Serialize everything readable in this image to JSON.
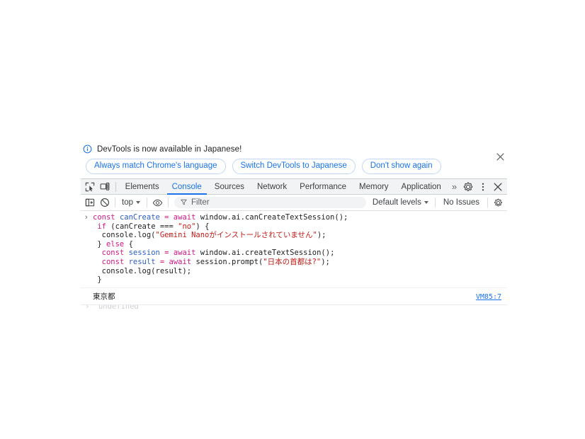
{
  "notification": {
    "icon": "info-circle-icon",
    "message": "DevTools is now available in Japanese!",
    "buttons": [
      {
        "label": "Always match Chrome's language",
        "name": "always-match-language-button"
      },
      {
        "label": "Switch DevTools to Japanese",
        "name": "switch-to-japanese-button"
      },
      {
        "label": "Don't show again",
        "name": "dont-show-again-button"
      }
    ],
    "close_icon": "close-icon",
    "accent_color": "#1a73e8"
  },
  "tabbar": {
    "left_icons": [
      {
        "name": "inspect-element-icon"
      },
      {
        "name": "device-toolbar-icon"
      }
    ],
    "tabs": [
      {
        "label": "Elements",
        "active": false
      },
      {
        "label": "Console",
        "active": true
      },
      {
        "label": "Sources",
        "active": false
      },
      {
        "label": "Network",
        "active": false
      },
      {
        "label": "Performance",
        "active": false
      },
      {
        "label": "Memory",
        "active": false
      },
      {
        "label": "Application",
        "active": false
      }
    ],
    "more_tabs_label": "»",
    "right_icons": [
      {
        "name": "settings-gear-icon"
      },
      {
        "name": "more-options-icon"
      },
      {
        "name": "close-devtools-icon"
      }
    ],
    "active_color": "#1a73e8"
  },
  "console_toolbar": {
    "sidebar_toggle_icon": "console-sidebar-toggle-icon",
    "clear_console_icon": "clear-console-icon",
    "context_selector": "top",
    "live_expression_icon": "eye-icon",
    "filter_icon": "filter-funnel-icon",
    "filter_value": "",
    "filter_placeholder": "Filter",
    "levels_label": "Default levels",
    "issues_label": "No Issues",
    "settings_icon": "console-settings-icon"
  },
  "console": {
    "input_lines": [
      [
        {
          "t": "kw",
          "v": "const "
        },
        {
          "t": "ident",
          "v": "canCreate "
        },
        {
          "t": "kw",
          "v": "= await "
        },
        {
          "t": "plain",
          "v": "window.ai.canCreateTextSession();"
        }
      ],
      [
        {
          "t": "plain",
          "v": " "
        },
        {
          "t": "kw",
          "v": "if "
        },
        {
          "t": "plain",
          "v": "(canCreate === "
        },
        {
          "t": "str",
          "v": "\"no\""
        },
        {
          "t": "plain",
          "v": ") {"
        }
      ],
      [
        {
          "t": "plain",
          "v": "  console.log("
        },
        {
          "t": "str",
          "v": "\"Gemini Nanoがインストールされていません\""
        },
        {
          "t": "plain",
          "v": ");"
        }
      ],
      [
        {
          "t": "plain",
          "v": " } "
        },
        {
          "t": "kw",
          "v": "else "
        },
        {
          "t": "plain",
          "v": "{"
        }
      ],
      [
        {
          "t": "plain",
          "v": "  "
        },
        {
          "t": "kw",
          "v": "const "
        },
        {
          "t": "ident",
          "v": "session "
        },
        {
          "t": "kw",
          "v": "= await "
        },
        {
          "t": "plain",
          "v": "window.ai.createTextSession();"
        }
      ],
      [
        {
          "t": "plain",
          "v": "  "
        },
        {
          "t": "kw",
          "v": "const "
        },
        {
          "t": "ident",
          "v": "result "
        },
        {
          "t": "kw",
          "v": "= await "
        },
        {
          "t": "plain",
          "v": "session.prompt("
        },
        {
          "t": "str",
          "v": "\"日本の首都は?\""
        },
        {
          "t": "plain",
          "v": ");"
        }
      ],
      [
        {
          "t": "plain",
          "v": "  console.log(result);"
        }
      ],
      [
        {
          "t": "plain",
          "v": " }"
        }
      ]
    ],
    "prompt_marker": "›",
    "result": {
      "text": "東京都",
      "source_link": "VM85:7",
      "link_color": "#1a73e8"
    },
    "clipped_next_line": "›  undefined"
  }
}
